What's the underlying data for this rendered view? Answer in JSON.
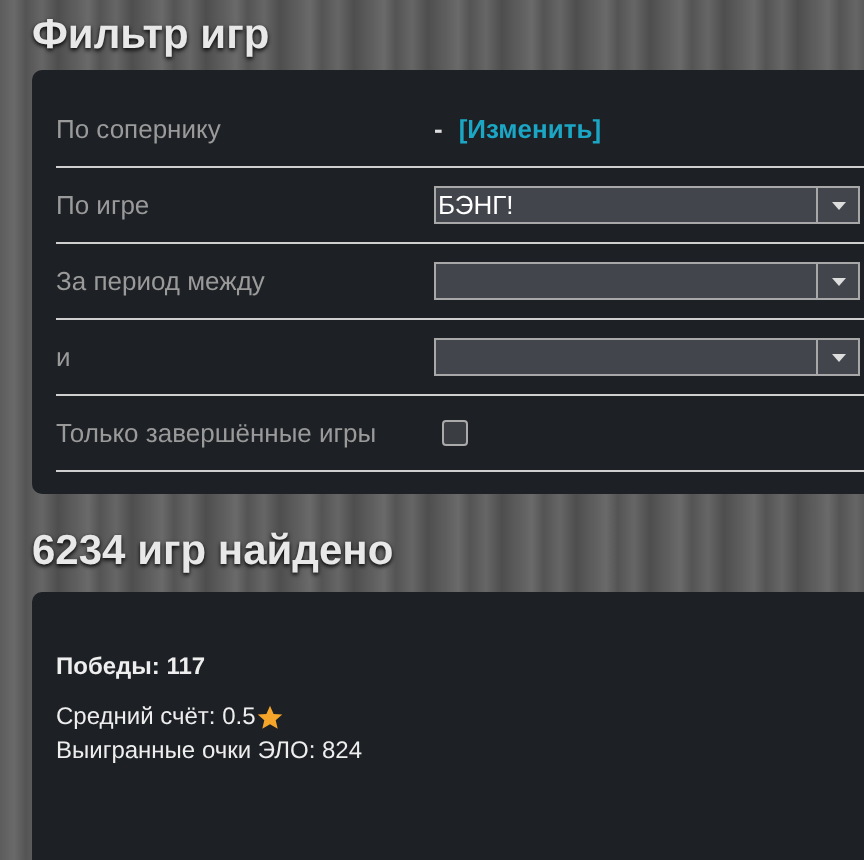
{
  "filter_title": "Фильтр игр",
  "filters": [
    {
      "kind": "link",
      "label": "По сопернику",
      "value": "-",
      "link": "[Изменить]"
    },
    {
      "kind": "select",
      "label": "По игре",
      "value": "БЭНГ!"
    },
    {
      "kind": "select",
      "label": "За период между"
    },
    {
      "kind": "select",
      "label": "и"
    },
    {
      "kind": "checkbox",
      "label": "Только завершённые игры",
      "checked": false
    }
  ],
  "results_title": {
    "count": "6234",
    "text": "игр найдено"
  },
  "stats": {
    "wins": "Победы: 117",
    "average_score": "Средний счёт: 0.5",
    "elo": "Выигранные очки ЭЛО: 824"
  }
}
